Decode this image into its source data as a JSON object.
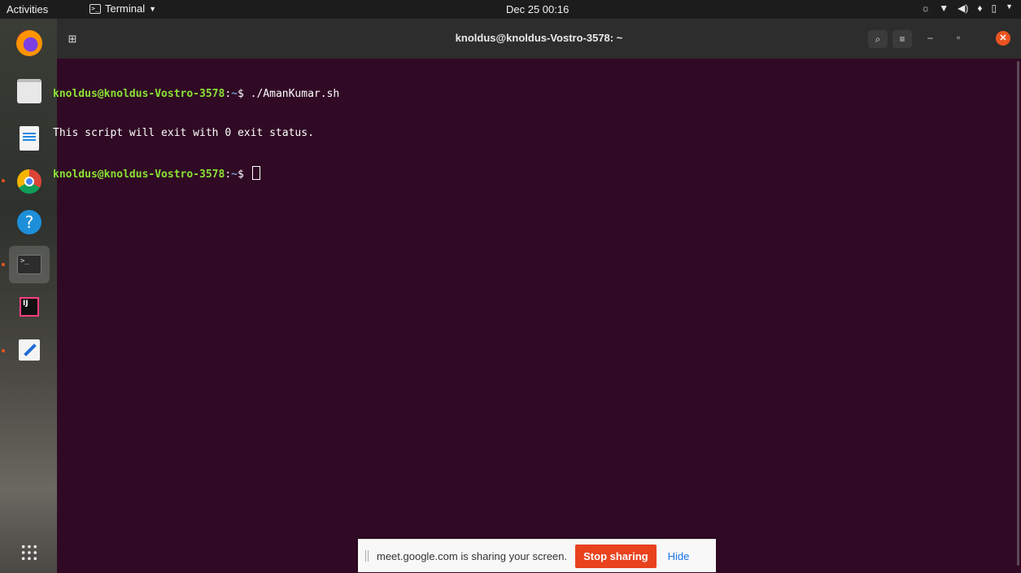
{
  "topbar": {
    "activities": "Activities",
    "app_name": "Terminal",
    "clock": "Dec 25  00:16",
    "tray_icons": [
      "brightness-icon",
      "wifi-icon",
      "volume-icon",
      "microphone-icon",
      "battery-icon",
      "system-menu-caret"
    ]
  },
  "dock": {
    "items": [
      "firefox",
      "files",
      "libreoffice-writer",
      "google-chrome",
      "help",
      "terminal",
      "intellij-idea",
      "text-editor"
    ],
    "show_apps_icon": "app-grid-icon"
  },
  "window": {
    "title": "knoldus@knoldus-Vostro-3578: ~"
  },
  "terminal": {
    "line1_user": "knoldus@knoldus-Vostro-3578",
    "line1_path": "~",
    "line1_cmd": "./AmanKumar.sh",
    "line2_output": "This script will exit with 0 exit status.",
    "line3_user": "knoldus@knoldus-Vostro-3578",
    "line3_path": "~"
  },
  "sharebar": {
    "message": "meet.google.com is sharing your screen.",
    "stop_label": "Stop sharing",
    "hide_label": "Hide"
  },
  "colors": {
    "terminal_bg": "#300a24",
    "prompt_user": "#8ae234",
    "prompt_path": "#729fcf",
    "accent": "#e95420",
    "stop_button": "#e8421f",
    "hide_link": "#1a73e8"
  }
}
